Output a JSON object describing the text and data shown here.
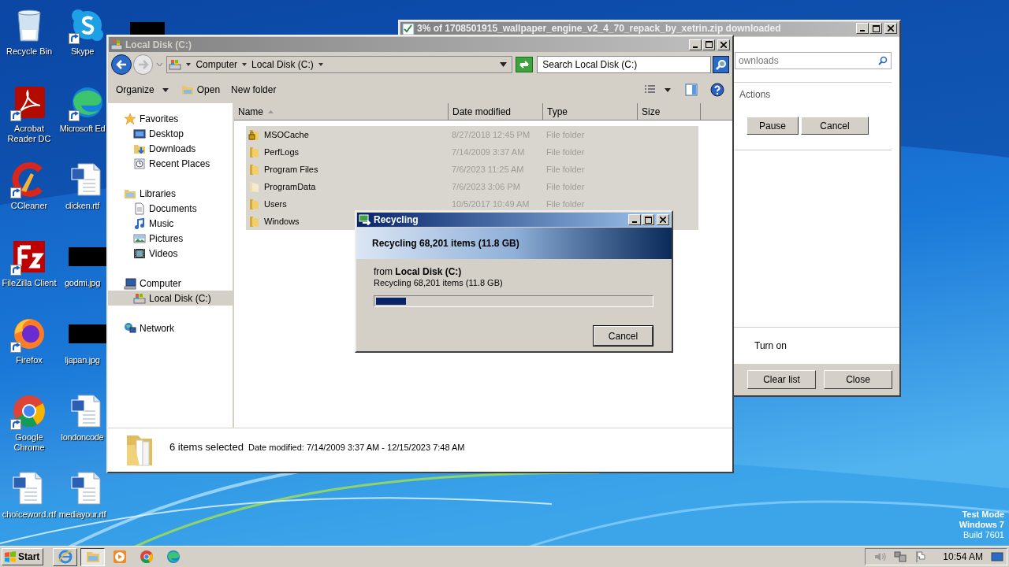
{
  "desktop": {
    "icons": [
      {
        "label": "Recycle Bin",
        "kind": "recycle",
        "shortcut": false
      },
      {
        "label": "Skype",
        "kind": "skype",
        "shortcut": true
      },
      {
        "label": "Acrobat Reader DC",
        "kind": "acrobat",
        "shortcut": true
      },
      {
        "label": "Microsoft Ed",
        "kind": "edge",
        "shortcut": true
      },
      {
        "label": "CCleaner",
        "kind": "ccleaner",
        "shortcut": true
      },
      {
        "label": "clicken.rtf",
        "kind": "word",
        "shortcut": false
      },
      {
        "label": "FileZilla Client",
        "kind": "filezilla",
        "shortcut": true
      },
      {
        "label": "godmi.jpg",
        "kind": "redacted",
        "shortcut": false
      },
      {
        "label": "Firefox",
        "kind": "firefox",
        "shortcut": true
      },
      {
        "label": "ljapan.jpg",
        "kind": "redacted",
        "shortcut": false
      },
      {
        "label": "Google Chrome",
        "kind": "chrome",
        "shortcut": true
      },
      {
        "label": "londoncode",
        "kind": "word",
        "shortcut": false
      },
      {
        "label": "choiceword.rtf",
        "kind": "word",
        "shortcut": false
      },
      {
        "label": "mediayour.rtf",
        "kind": "word",
        "shortcut": false
      }
    ],
    "system_text": [
      "Test Mode",
      "Windows 7",
      "Build 7601"
    ]
  },
  "download_window": {
    "title": "3% of 1708501915_wallpaper_engine_v2_4_70_repack_by_xetrin.zip downloaded",
    "search_placeholder": "ownloads",
    "section_label": "Actions",
    "buttons": [
      "Pause",
      "Cancel"
    ],
    "link": "Turn on",
    "footer_buttons": [
      "Clear list",
      "Close"
    ]
  },
  "explorer": {
    "title": "Local Disk (C:)",
    "breadcrumb": [
      "Computer",
      "Local Disk (C:)"
    ],
    "search_placeholder": "Search Local Disk (C:)",
    "toolbar": [
      "Organize",
      "Open",
      "New folder"
    ],
    "nav": [
      {
        "label": "Favorites",
        "kind": "favorites",
        "selected": false,
        "children": [
          {
            "label": "Desktop",
            "kind": "desktop",
            "selected": false
          },
          {
            "label": "Downloads",
            "kind": "downloads",
            "selected": false
          },
          {
            "label": "Recent Places",
            "kind": "recent",
            "selected": false
          }
        ]
      },
      {
        "label": "Libraries",
        "kind": "libraries",
        "selected": false,
        "children": [
          {
            "label": "Documents",
            "kind": "documents",
            "selected": false
          },
          {
            "label": "Music",
            "kind": "music",
            "selected": false
          },
          {
            "label": "Pictures",
            "kind": "pictures",
            "selected": false
          },
          {
            "label": "Videos",
            "kind": "videos",
            "selected": false
          }
        ]
      },
      {
        "label": "Computer",
        "kind": "computer",
        "selected": false,
        "children": [
          {
            "label": "Local Disk (C:)",
            "kind": "drive",
            "selected": true
          }
        ]
      },
      {
        "label": "Network",
        "kind": "network",
        "selected": false
      }
    ],
    "columns": [
      "Name",
      "Date modified",
      "Type",
      "Size"
    ],
    "rows": [
      {
        "name": "MSOCache",
        "date": "8/27/2018 12:45 PM",
        "type": "File folder",
        "kind": "locked",
        "selected": true
      },
      {
        "name": "PerfLogs",
        "date": "7/14/2009 3:37 AM",
        "type": "File folder",
        "kind": "folder",
        "selected": true
      },
      {
        "name": "Program Files",
        "date": "7/6/2023 11:25 AM",
        "type": "File folder",
        "kind": "folder",
        "selected": true
      },
      {
        "name": "ProgramData",
        "date": "7/6/2023 3:06 PM",
        "type": "File folder",
        "kind": "hidden",
        "selected": true
      },
      {
        "name": "Users",
        "date": "10/5/2017 10:49 AM",
        "type": "File folder",
        "kind": "folder",
        "selected": true
      },
      {
        "name": "Windows",
        "kind": "folder",
        "selected": true
      }
    ],
    "status": {
      "count": "6 items selected",
      "details": "Date modified: 7/14/2009 3:37 AM - 12/15/2023 7:48 AM"
    }
  },
  "recycling_dialog": {
    "title": "Recycling",
    "header": "Recycling 68,201 items (11.8 GB)",
    "source": "from **Local Disk (C:)**",
    "detail": "Recycling 68,201 items (11.8 GB)",
    "level": 0.11,
    "button": "Cancel"
  },
  "taskbar": {
    "start": "Start",
    "apps": [
      {
        "kind": "ie",
        "running": true,
        "selected": false
      },
      {
        "kind": "explorer",
        "running": true,
        "selected": true
      },
      {
        "kind": "media",
        "running": false,
        "selected": false
      },
      {
        "kind": "chrome",
        "running": false,
        "selected": false
      },
      {
        "kind": "edge",
        "running": false,
        "selected": false
      }
    ],
    "clock": "10:54 AM"
  }
}
